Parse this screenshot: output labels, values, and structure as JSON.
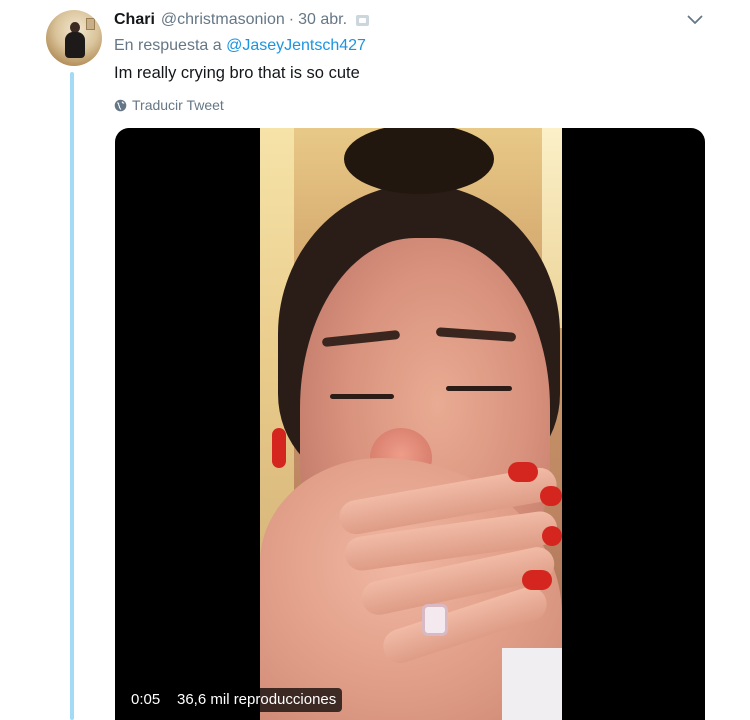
{
  "tweet": {
    "author_name": "Chari",
    "author_handle": "@christmasonion",
    "separator": "·",
    "timestamp": "30 abr.",
    "reply_prefix": "En respuesta a",
    "reply_to_handle": "@JaseyJentsch427",
    "text": "Im really crying bro that is so cute",
    "translate_label": "Traducir Tweet"
  },
  "video": {
    "elapsed": "0:05",
    "views": "36,6 mil reproducciones"
  },
  "icons": {
    "caret": "chevron-down-icon",
    "translate": "globe-icon"
  },
  "colors": {
    "link": "#1b95e0",
    "muted": "#657786",
    "thread_line": "#a3dbf7",
    "nail": "#d4261f"
  }
}
